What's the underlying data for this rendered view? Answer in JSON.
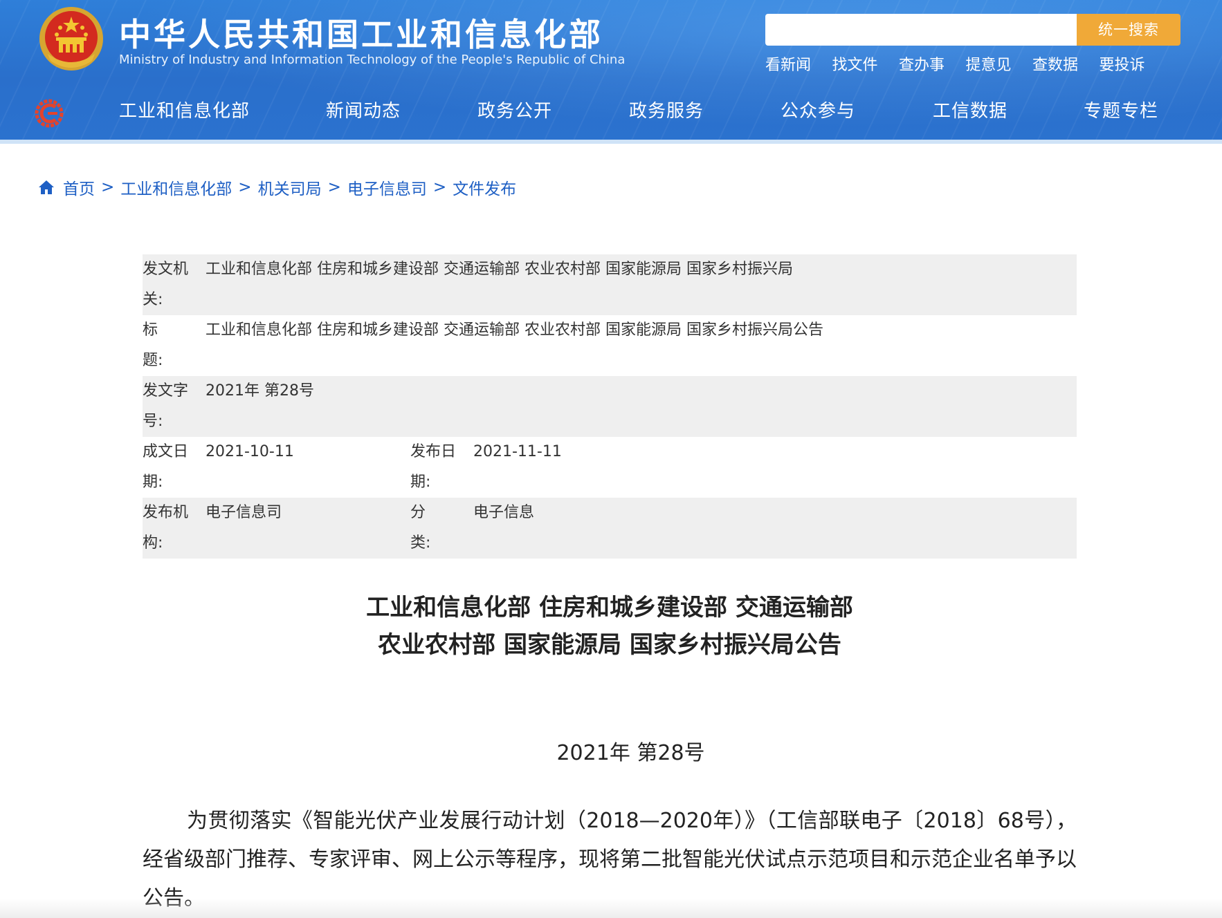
{
  "header": {
    "title": "中华人民共和国工业和信息化部",
    "subtitle": "Ministry of Industry and Information Technology of the People's Republic of China",
    "search_placeholder": "",
    "search_button": "统一搜索",
    "quick_links": [
      "看新闻",
      "找文件",
      "查办事",
      "提意见",
      "查数据",
      "要投诉"
    ],
    "nav": [
      "工业和信息化部",
      "新闻动态",
      "政务公开",
      "政务服务",
      "公众参与",
      "工信数据",
      "专题专栏"
    ],
    "colors": {
      "header_blue": "#2a6fcb",
      "search_button": "#f0a938"
    }
  },
  "breadcrumb": {
    "separator": ">",
    "items": [
      "首页",
      "工业和信息化部",
      "机关司局",
      "电子信息司",
      "文件发布"
    ]
  },
  "info": {
    "issuing_agency_label": "发文机关:",
    "issuing_agency": "工业和信息化部 住房和城乡建设部 交通运输部 农业农村部 国家能源局 国家乡村振兴局",
    "title_label": "标　　题:",
    "title": "工业和信息化部 住房和城乡建设部 交通运输部 农业农村部 国家能源局 国家乡村振兴局公告",
    "doc_number_label": "发文字号:",
    "doc_number": "2021年 第28号",
    "written_date_label": "成文日期:",
    "written_date": "2021-10-11",
    "publish_date_label": "发布日期:",
    "publish_date": "2021-11-11",
    "publisher_label": "发布机构:",
    "publisher": "电子信息司",
    "category_label": "分　　类:",
    "category": "电子信息"
  },
  "document": {
    "title_line1": "工业和信息化部 住房和城乡建设部 交通运输部",
    "title_line2": "农业农村部 国家能源局 国家乡村振兴局公告",
    "number": "2021年 第28号",
    "body": "为贯彻落实《智能光伏产业发展行动计划（2018—2020年）》（工信部联电子〔2018〕68号），经省级部门推荐、专家评审、网上公示等程序，现将第二批智能光伏试点示范项目和示范企业名单予以公告。"
  }
}
